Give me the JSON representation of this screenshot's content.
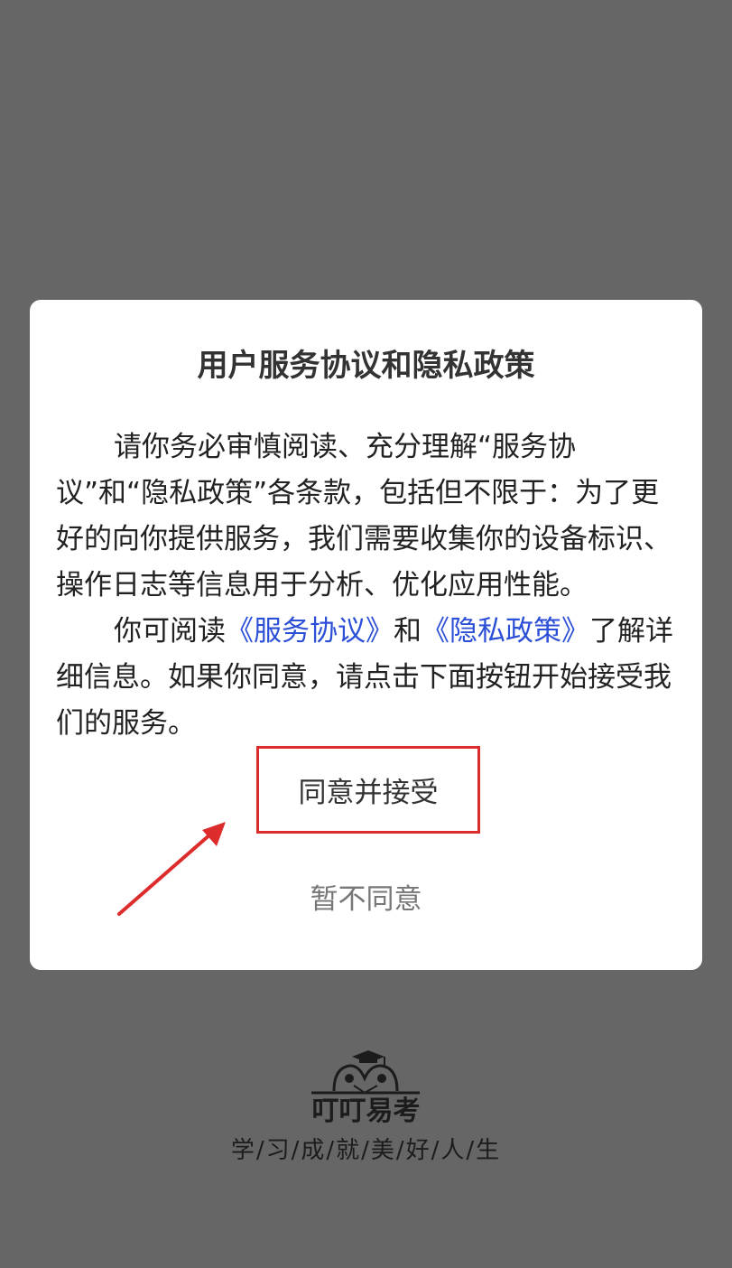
{
  "dialog": {
    "title": "用户服务协议和隐私政策",
    "paragraph1": "请你务必审慎阅读、充分理解“服务协议”和“隐私政策”各条款，包括但不限于：为了更好的向你提供服务，我们需要收集你的设备标识、操作日志等信息用于分析、优化应用性能。",
    "p2_prefix": "你可阅读",
    "link_service": "《服务协议》",
    "p2_and": "和",
    "link_privacy": "《隐私政策》",
    "p2_suffix": "了解详细信息。如果你同意，请点击下面按钮开始接受我们的服务。",
    "accept_label": "同意并接受",
    "decline_label": "暂不同意"
  },
  "branding": {
    "name": "叮叮易考",
    "slogan": "学/习/成/就/美/好/人/生"
  },
  "colors": {
    "overlay": "#666666",
    "link": "#2b4fd6",
    "highlight": "#dd2c2c"
  }
}
